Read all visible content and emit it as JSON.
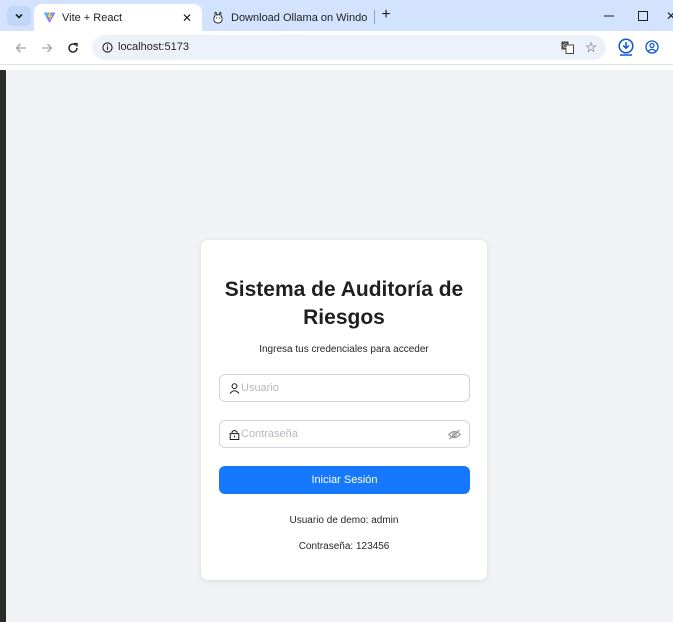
{
  "browser": {
    "tabs": [
      {
        "title": "Vite + React",
        "icon": "vite-logo-icon",
        "active": true
      },
      {
        "title": "Download Ollama on Windows",
        "icon": "ollama-logo-icon",
        "active": false
      }
    ],
    "url": "localhost:5173",
    "colors": {
      "tab_strip": "#d3e3fd",
      "omnibox": "#edf2fa"
    }
  },
  "login": {
    "title": "Sistema de Auditoría de Riesgos",
    "subtitle": "Ingresa tus credenciales para acceder",
    "username": {
      "placeholder": "Usuario",
      "value": "",
      "icon": "user-icon"
    },
    "password": {
      "placeholder": "Contraseña",
      "value": "",
      "icon": "lock-icon",
      "toggle_icon": "eye-invisible-icon"
    },
    "submit_label": "Iniciar Sesión",
    "demo_user": "Usuario de demo: admin",
    "demo_password": "Contraseña: 123456"
  },
  "colors": {
    "page_background": "#f0f2f5",
    "primary_button": "#1677ff",
    "card_background": "#ffffff"
  }
}
